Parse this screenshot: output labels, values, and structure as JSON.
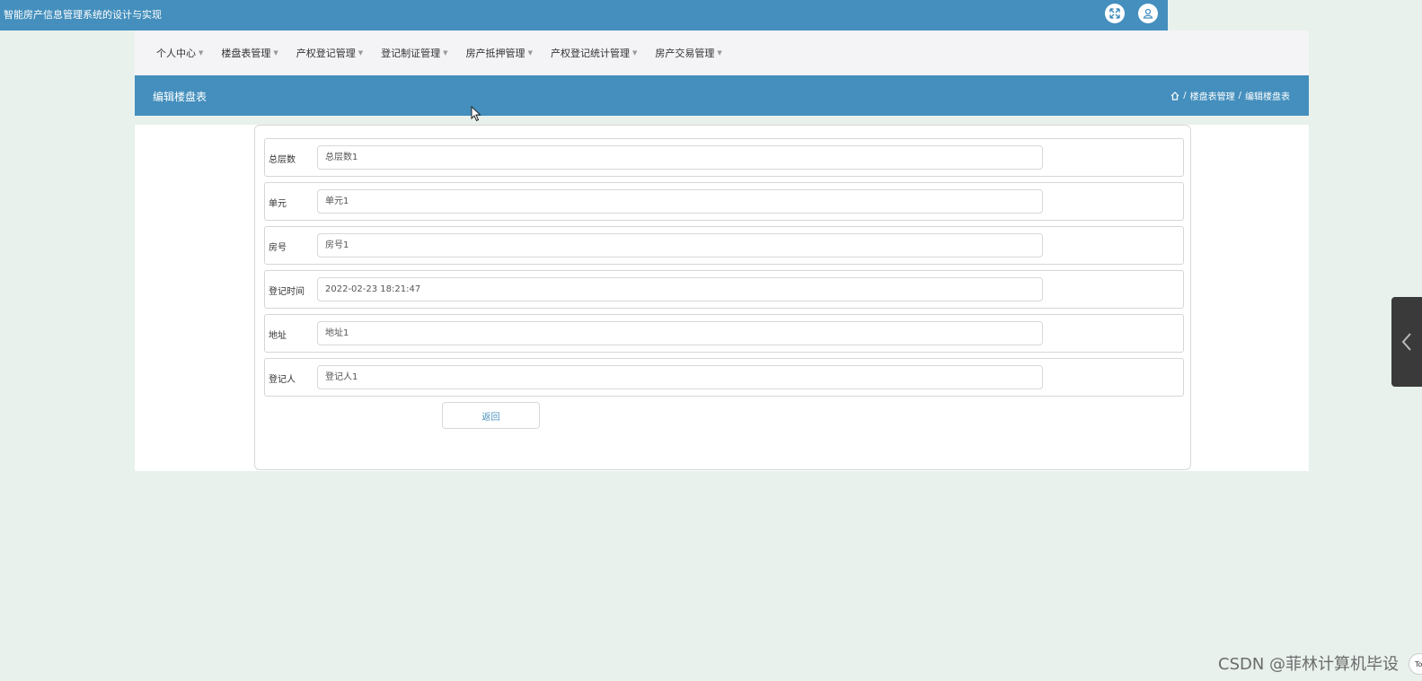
{
  "app": {
    "title": "智能房产信息管理系统的设计与实现"
  },
  "top_icons": [
    "expand-icon",
    "user-icon"
  ],
  "nav": {
    "items": [
      {
        "label": "个人中心"
      },
      {
        "label": "楼盘表管理"
      },
      {
        "label": "产权登记管理"
      },
      {
        "label": "登记制证管理"
      },
      {
        "label": "房产抵押管理"
      },
      {
        "label": "产权登记统计管理"
      },
      {
        "label": "房产交易管理"
      }
    ]
  },
  "header": {
    "page_title": "编辑楼盘表",
    "breadcrumb": {
      "sep": "/",
      "level1": "楼盘表管理",
      "level2": "编辑楼盘表"
    }
  },
  "form": {
    "fields": [
      {
        "label": "总层数",
        "value": "总层数1"
      },
      {
        "label": "单元",
        "value": "单元1"
      },
      {
        "label": "房号",
        "value": "房号1"
      },
      {
        "label": "登记时间",
        "value": "2022-02-23 18:21:47"
      },
      {
        "label": "地址",
        "value": "地址1"
      },
      {
        "label": "登记人",
        "value": "登记人1"
      }
    ],
    "back_label": "返回"
  },
  "watermark": "CSDN @菲林计算机毕设",
  "top_button": "To",
  "colors": {
    "primary": "#448fbd",
    "background": "#e8f1ec",
    "nav_bg": "#f4f3f6"
  }
}
